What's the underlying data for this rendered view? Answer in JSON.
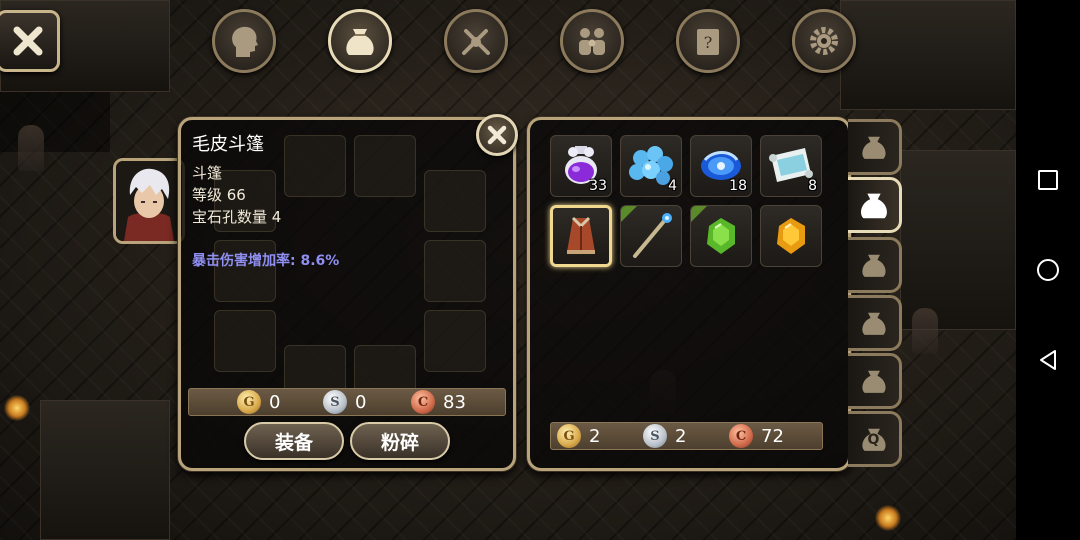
{
  "top_menu": {
    "buttons": [
      {
        "name": "character-menu-button",
        "icon": "head-silhouette-icon",
        "active": false
      },
      {
        "name": "inventory-menu-button",
        "icon": "sack-icon",
        "active": true
      },
      {
        "name": "skills-menu-button",
        "icon": "crossed-swords-icon",
        "active": false
      },
      {
        "name": "party-menu-button",
        "icon": "party-icon",
        "active": false
      },
      {
        "name": "quest-menu-button",
        "icon": "quest-scroll-icon",
        "active": false
      },
      {
        "name": "settings-menu-button",
        "icon": "gear-icon",
        "active": false
      }
    ]
  },
  "item_detail": {
    "name": "毛皮斗篷",
    "type": "斗篷",
    "level": "等级 66",
    "sockets": "宝石孔数量 4",
    "bonus": "暴击伤害增加率: 8.6%",
    "currency": {
      "gold": "0",
      "silver": "0",
      "copper": "83"
    },
    "equip_label": "装备",
    "shatter_label": "粉碎"
  },
  "inventory": {
    "items": [
      {
        "name": "purple-potion",
        "icon": "purple-potion-icon",
        "qty": "33"
      },
      {
        "name": "blue-orbs",
        "icon": "blue-orbs-icon",
        "qty": "4"
      },
      {
        "name": "blue-crystal",
        "icon": "blue-crystal-icon",
        "qty": "18"
      },
      {
        "name": "scroll-map",
        "icon": "scroll-icon",
        "qty": "8"
      },
      {
        "name": "fur-cloak",
        "icon": "cloak-icon",
        "qty": ""
      },
      {
        "name": "staff",
        "icon": "staff-icon",
        "qty": ""
      },
      {
        "name": "green-gem",
        "icon": "green-gem-icon",
        "qty": ""
      },
      {
        "name": "amber-gem",
        "icon": "amber-gem-icon",
        "qty": ""
      }
    ],
    "currency": {
      "gold": "2",
      "silver": "2",
      "copper": "72"
    }
  },
  "coin_glyphs": {
    "gold": "G",
    "silver": "S",
    "copper": "C"
  },
  "side_tabs": [
    {
      "label": "",
      "active": false
    },
    {
      "label": "",
      "active": true
    },
    {
      "label": "",
      "active": false
    },
    {
      "label": "",
      "active": false
    },
    {
      "label": "",
      "active": false
    },
    {
      "label": "Q",
      "active": false
    }
  ],
  "colors": {
    "frame": "#b8a37a",
    "bonus_text": "#8f8ff2",
    "selected_slot": "#f0d890"
  }
}
